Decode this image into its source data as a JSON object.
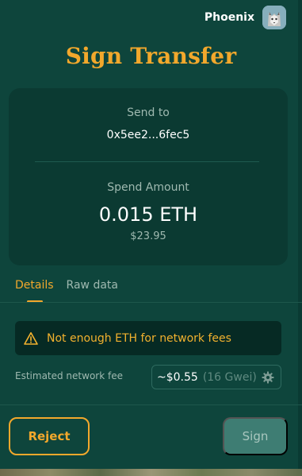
{
  "header": {
    "username": "Phoenix",
    "avatar_icon": "husky-avatar"
  },
  "title": "Sign Transfer",
  "transfer": {
    "send_to_label": "Send to",
    "send_to_address": "0x5ee2...6fec5",
    "spend_label": "Spend Amount",
    "spend_amount": "0.015 ETH",
    "spend_usd": "$23.95"
  },
  "tabs": [
    {
      "label": "Details",
      "active": true
    },
    {
      "label": "Raw data",
      "active": false
    }
  ],
  "warning": {
    "icon": "warning-triangle-icon",
    "text": "Not enough ETH for network fees"
  },
  "fee": {
    "label": "Estimated network fee",
    "value": "~$0.55",
    "gwei": "(16 Gwei)",
    "settings_icon": "gear-icon"
  },
  "actions": {
    "reject_label": "Reject",
    "sign_label": "Sign"
  },
  "colors": {
    "background": "#0e453c",
    "card": "#0b3a32",
    "accent": "#f2a82c",
    "sign_disabled": "#3e7d73"
  }
}
